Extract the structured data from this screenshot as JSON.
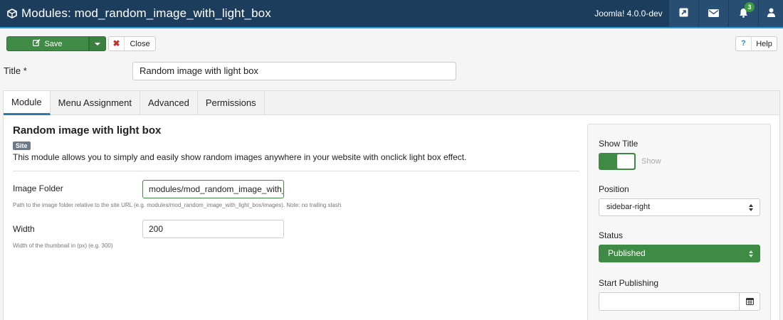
{
  "header": {
    "title": "Modules: mod_random_image_with_light_box",
    "version": "Joomla! 4.0.0-dev",
    "notification_count": "3"
  },
  "toolbar": {
    "save_label": "Save",
    "close_label": "Close",
    "help_mark": "?",
    "help_label": "Help"
  },
  "title_field": {
    "label": "Title *",
    "value": "Random image with light box"
  },
  "tabs": [
    {
      "label": "Module",
      "active": true
    },
    {
      "label": "Menu Assignment"
    },
    {
      "label": "Advanced"
    },
    {
      "label": "Permissions"
    }
  ],
  "module": {
    "heading": "Random image with light box",
    "badge": "Site",
    "description": "This module allows you to simply and easily show random images anywhere in your website with onclick light box effect."
  },
  "fields": {
    "image_folder": {
      "label": "Image Folder",
      "value": "modules/mod_random_image_with_light_box/images",
      "help": "Path to the image folder relative to the site URL (e.g. modules/mod_random_image_with_light_box/images). Note: no trailing slash"
    },
    "width": {
      "label": "Width",
      "value": "200",
      "help": "Width of the thumbnail in (px) (e.g. 300)"
    }
  },
  "sidebar": {
    "show_title": {
      "label": "Show Title",
      "state_text": "Show"
    },
    "position": {
      "label": "Position",
      "selected": "sidebar-right"
    },
    "status": {
      "label": "Status",
      "selected": "Published"
    },
    "start_publishing": {
      "label": "Start Publishing",
      "value": ""
    }
  },
  "colors": {
    "header_bg": "#1c3d5c",
    "accent_blue": "#2a9fd6",
    "success_green": "#3f8a45"
  }
}
